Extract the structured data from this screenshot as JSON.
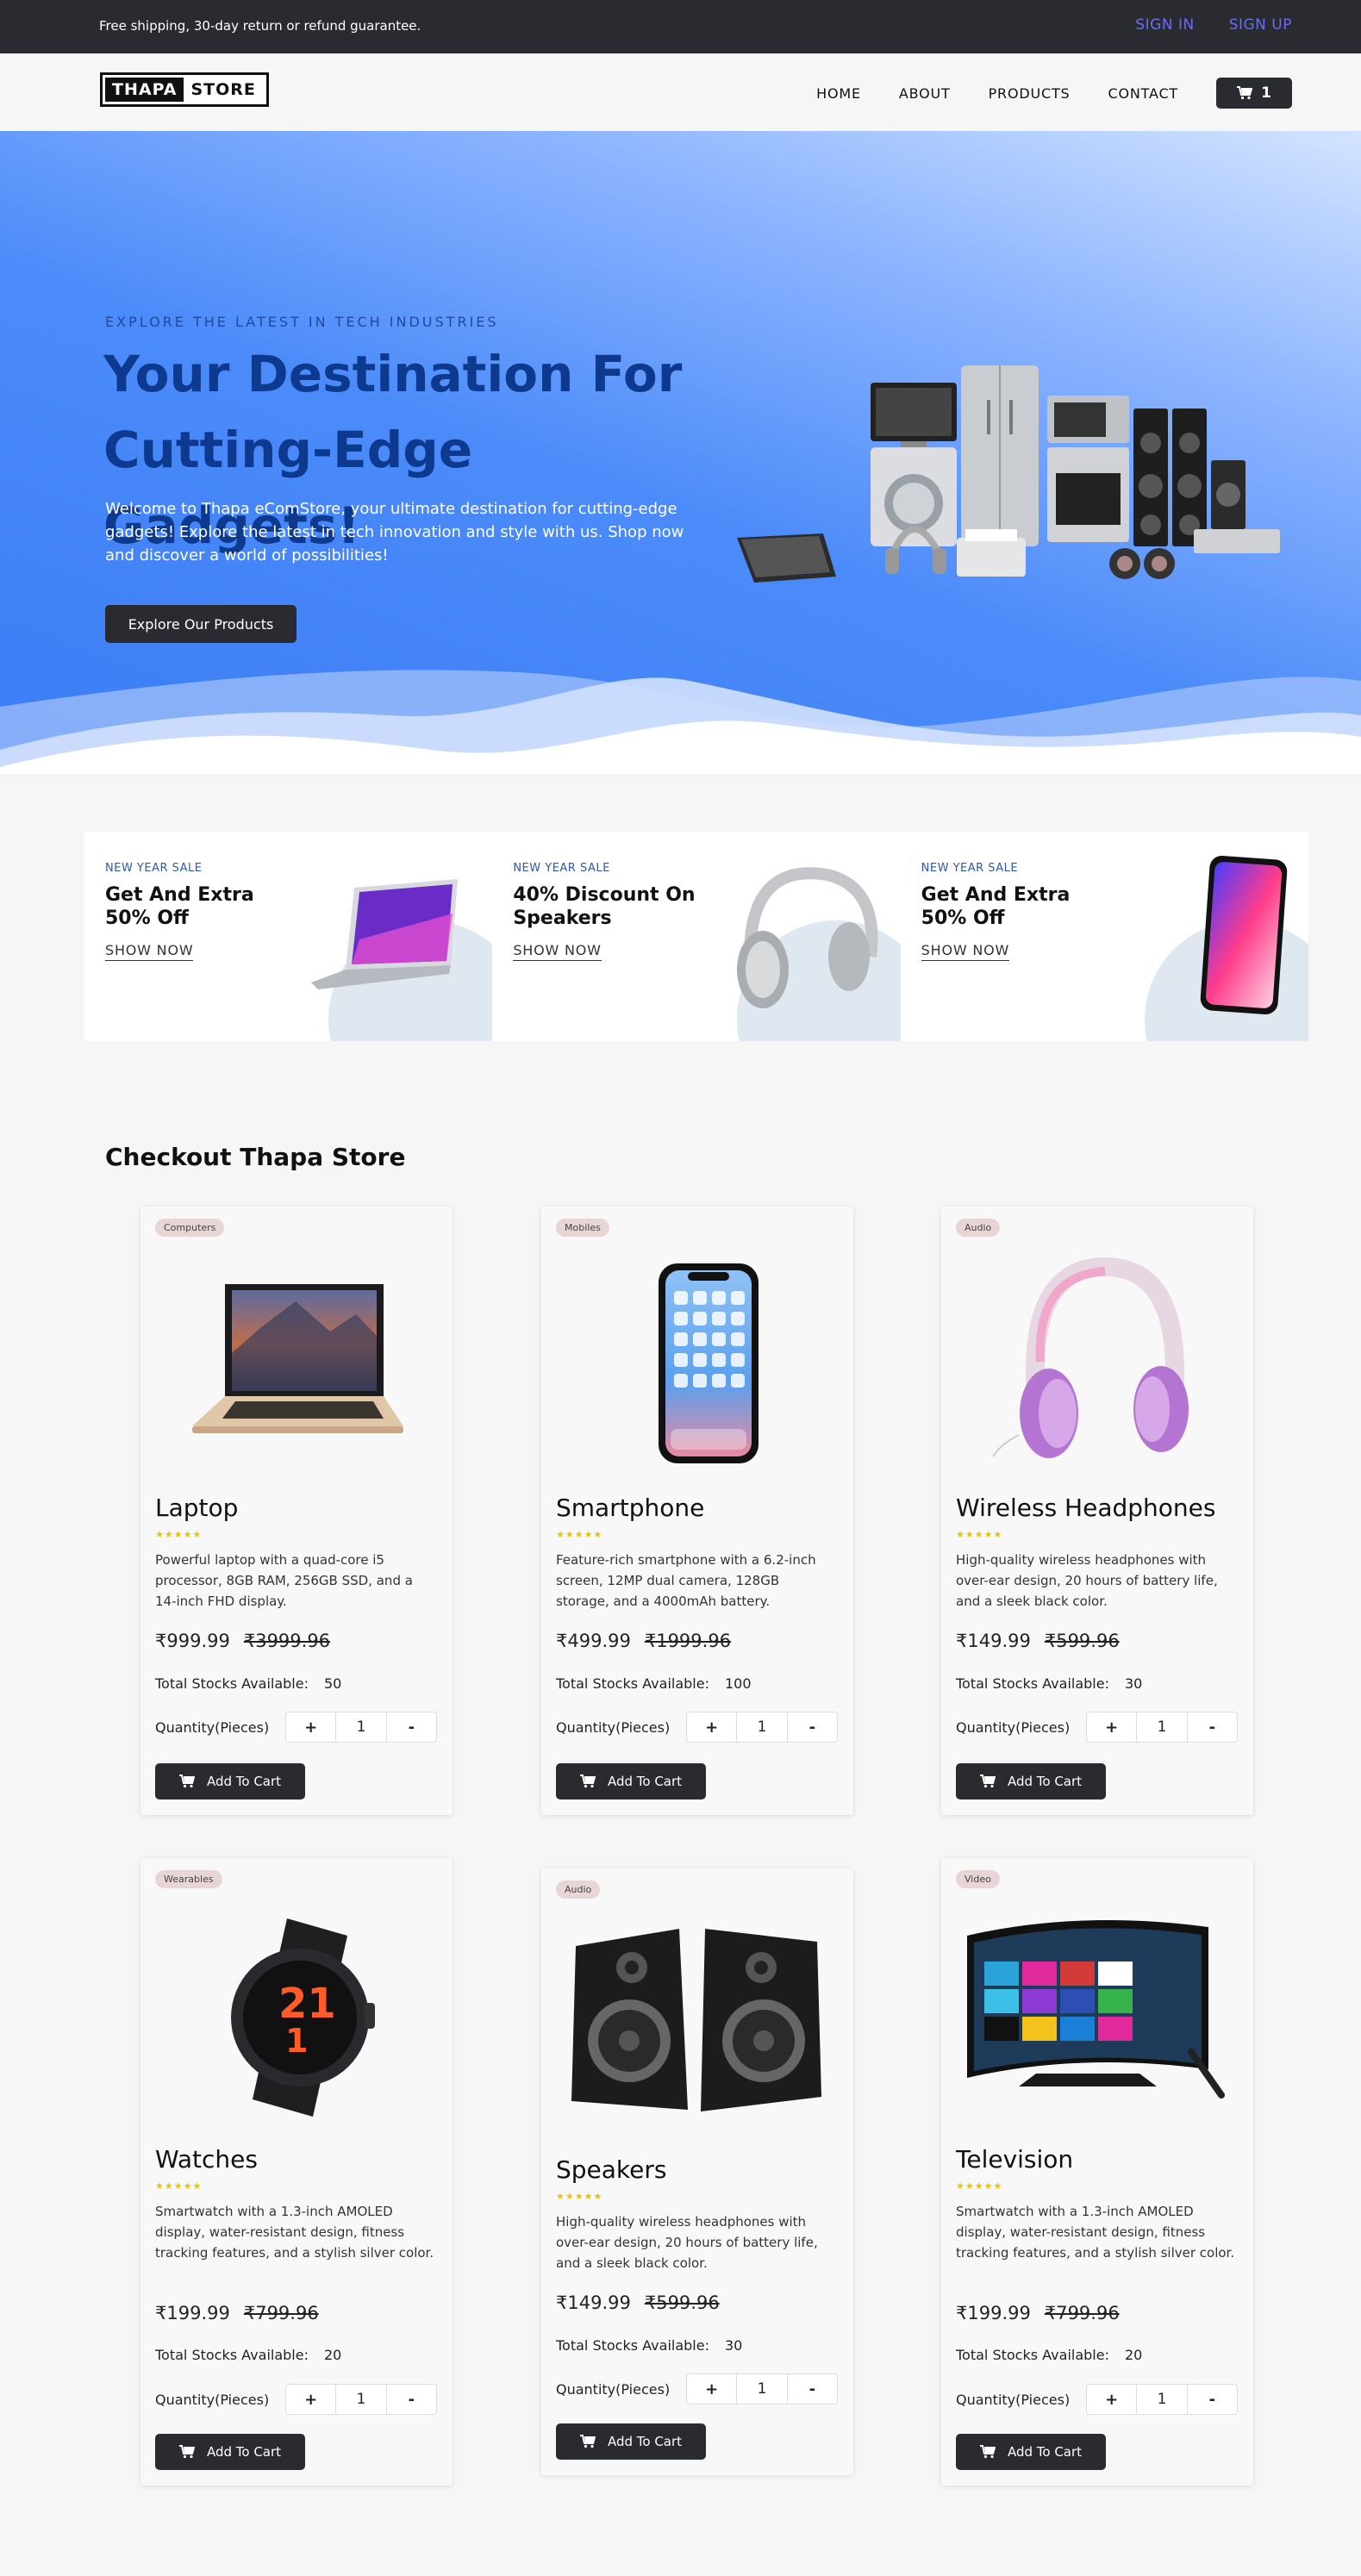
{
  "topbar": {
    "message": "Free shipping, 30-day return or refund guarantee.",
    "sign_in": "SIGN IN",
    "sign_up": "SIGN UP"
  },
  "header": {
    "logo_left": "THAPA",
    "logo_right": "STORE",
    "nav": [
      "HOME",
      "ABOUT",
      "PRODUCTS",
      "CONTACT"
    ],
    "cart_count": "1",
    "cart_icon": "cart-icon"
  },
  "hero": {
    "eyebrow": "EXPLORE THE LATEST IN TECH INDUSTRIES",
    "title": "Your Destination For Cutting-Edge Gadgets!",
    "lead": "Welcome to Thapa eComStore, your ultimate destination for cutting-edge gadgets! Explore the latest in tech innovation and style with us. Shop now and discover a world of possibilities!",
    "cta": "Explore Our Products"
  },
  "promos": [
    {
      "tag": "NEW YEAR SALE",
      "title": "Get And Extra 50% Off",
      "link": "SHOW NOW",
      "icon": "laptop"
    },
    {
      "tag": "NEW YEAR SALE",
      "title": "40% Discount On Speakers",
      "link": "SHOW NOW",
      "icon": "headphones"
    },
    {
      "tag": "NEW YEAR SALE",
      "title": "Get And Extra 50% Off",
      "link": "SHOW NOW",
      "icon": "smartphone"
    }
  ],
  "section_title": "Checkout Thapa Store",
  "labels": {
    "stock": "Total Stocks Available:",
    "quantity": "Quantity(Pieces)",
    "add_to_cart": "Add To Cart",
    "plus": "+",
    "minus": "-"
  },
  "products": [
    {
      "category": "Computers",
      "name": "Laptop",
      "desc": "Powerful laptop with a quad-core i5 processor, 8GB RAM, 256GB SSD, and a 14-inch FHD display.",
      "price": "₹999.99",
      "old_price": "₹3999.96",
      "stock": "50",
      "qty": "1"
    },
    {
      "category": "Mobiles",
      "name": "Smartphone",
      "desc": "Feature-rich smartphone with a 6.2-inch screen, 12MP dual camera, 128GB storage, and a 4000mAh battery.",
      "price": "₹499.99",
      "old_price": "₹1999.96",
      "stock": "100",
      "qty": "1"
    },
    {
      "category": "Audio",
      "name": "Wireless Headphones",
      "desc": "High-quality wireless headphones with over-ear design, 20 hours of battery life, and a sleek black color.",
      "price": "₹149.99",
      "old_price": "₹599.96",
      "stock": "30",
      "qty": "1"
    },
    {
      "category": "Wearables",
      "name": "Watches",
      "desc": "Smartwatch with a 1.3-inch AMOLED display, water-resistant design, fitness tracking features, and a stylish silver color.",
      "price": "₹199.99",
      "old_price": "₹799.96",
      "stock": "20",
      "qty": "1"
    },
    {
      "category": "Audio",
      "name": "Speakers",
      "desc": "High-quality wireless headphones with over-ear design, 20 hours of battery life, and a sleek black color.",
      "price": "₹149.99",
      "old_price": "₹599.96",
      "stock": "30",
      "qty": "1"
    },
    {
      "category": "Video",
      "name": "Television",
      "desc": "Smartwatch with a 1.3-inch AMOLED display, water-resistant design, fitness tracking features, and a stylish silver color.",
      "price": "₹199.99",
      "old_price": "₹799.96",
      "stock": "20",
      "qty": "1"
    }
  ]
}
